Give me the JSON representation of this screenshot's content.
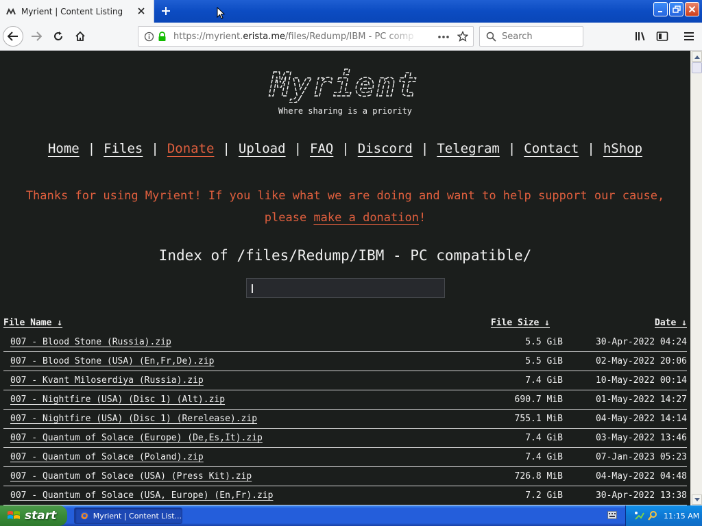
{
  "browser": {
    "tab_title": "Myrient | Content Listing",
    "url_host": "https://myrient.",
    "url_domain": "erista.me",
    "url_path": "/files/Redump/IBM - PC compatible",
    "search_placeholder": "Search"
  },
  "site": {
    "logo_text": "Myrient",
    "tagline": "Where sharing is a priority",
    "nav": {
      "home": "Home",
      "files": "Files",
      "donate": "Donate",
      "upload": "Upload",
      "faq": "FAQ",
      "discord": "Discord",
      "telegram": "Telegram",
      "contact": "Contact",
      "hshop": "hShop",
      "separator": "|"
    },
    "donate_msg_before": "Thanks for using Myrient! If you like what we are doing and want to help support our cause, please ",
    "donate_link": "make a donation",
    "donate_msg_after": "!",
    "index_title": "Index of /files/Redump/IBM - PC compatible/",
    "columns": {
      "name": "File Name  ↓",
      "size": "File Size  ↓",
      "date": "Date  ↓"
    },
    "files": [
      {
        "name": "007 - Blood Stone (Russia).zip",
        "size": "5.5 GiB",
        "date": "30-Apr-2022 04:24"
      },
      {
        "name": "007 - Blood Stone (USA) (En,Fr,De).zip",
        "size": "5.5 GiB",
        "date": "02-May-2022 20:06"
      },
      {
        "name": "007 - Kvant Miloserdiya (Russia).zip",
        "size": "7.4 GiB",
        "date": "10-May-2022 00:14"
      },
      {
        "name": "007 - Nightfire (USA) (Disc 1) (Alt).zip",
        "size": "690.7 MiB",
        "date": "01-May-2022 14:27"
      },
      {
        "name": "007 - Nightfire (USA) (Disc 1) (Rerelease).zip",
        "size": "755.1 MiB",
        "date": "04-May-2022 14:14"
      },
      {
        "name": "007 - Quantum of Solace (Europe) (De,Es,It).zip",
        "size": "7.4 GiB",
        "date": "03-May-2022 13:46"
      },
      {
        "name": "007 - Quantum of Solace (Poland).zip",
        "size": "7.4 GiB",
        "date": "07-Jan-2023 05:23"
      },
      {
        "name": "007 - Quantum of Solace (USA) (Press Kit).zip",
        "size": "726.8 MiB",
        "date": "04-May-2022 04:48"
      },
      {
        "name": "007 - Quantum of Solace (USA, Europe) (En,Fr).zip",
        "size": "7.2 GiB",
        "date": "30-Apr-2022 13:38"
      }
    ]
  },
  "taskbar": {
    "start_label": "start",
    "task_label": "Myrient | Content List...",
    "clock": "11:15 AM"
  },
  "colors": {
    "accent": "#e05f3e",
    "page_bg": "#1b1e1c"
  }
}
